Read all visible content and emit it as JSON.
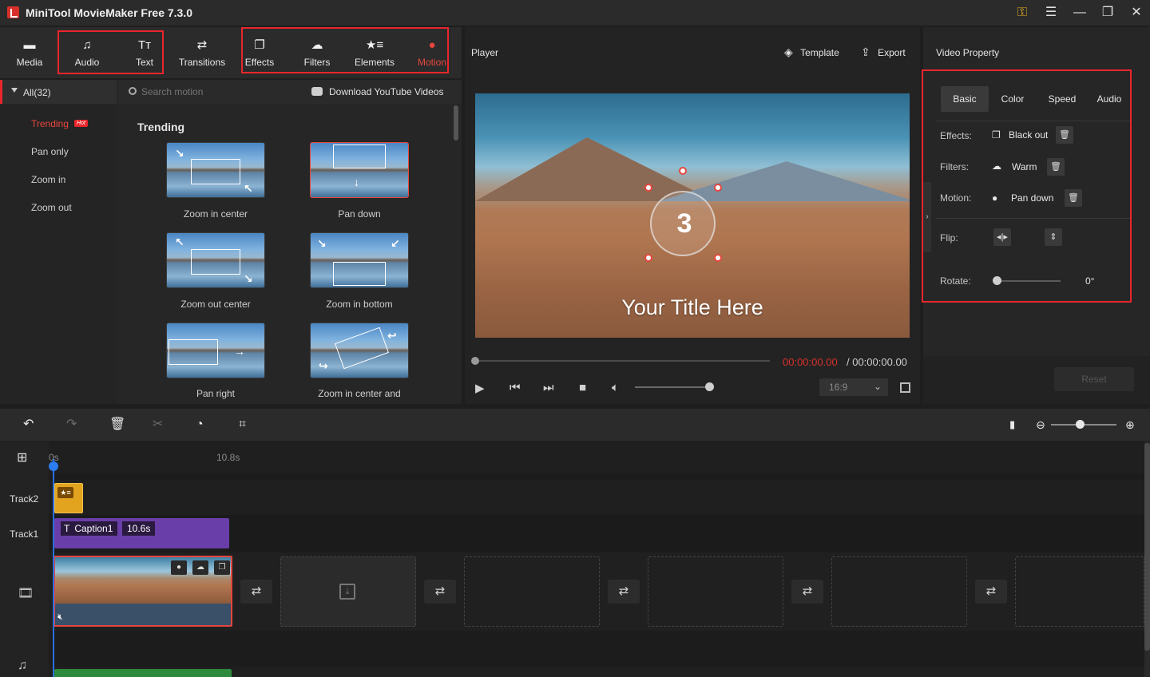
{
  "window": {
    "title": "MiniTool MovieMaker Free 7.3.0",
    "controls": [
      "key-icon",
      "menu-icon",
      "minimize-icon",
      "maximize-icon",
      "close-icon"
    ]
  },
  "toolbar": {
    "items": [
      {
        "label": "Media",
        "icon": "media-icon"
      },
      {
        "label": "Audio",
        "icon": "music-note-icon"
      },
      {
        "label": "Text",
        "icon": "text-icon"
      },
      {
        "label": "Transitions",
        "icon": "transitions-icon"
      },
      {
        "label": "Effects",
        "icon": "effects-icon"
      },
      {
        "label": "Filters",
        "icon": "filters-icon"
      },
      {
        "label": "Elements",
        "icon": "elements-icon"
      },
      {
        "label": "Motion",
        "icon": "motion-icon"
      }
    ],
    "active": "Motion",
    "accent": "#e8262c"
  },
  "library": {
    "category_header": "All(32)",
    "categories": [
      "Trending",
      "Pan only",
      "Zoom in",
      "Zoom out"
    ],
    "hot_badge": "Hot",
    "search_placeholder": "Search motion",
    "youtube_link": "Download YouTube Videos",
    "section_title": "Trending",
    "thumbnails": [
      {
        "label": "Zoom in center"
      },
      {
        "label": "Pan down"
      },
      {
        "label": "Zoom out center"
      },
      {
        "label": "Zoom in bottom"
      },
      {
        "label": "Pan right"
      },
      {
        "label": "Zoom in center and"
      }
    ]
  },
  "player": {
    "label": "Player",
    "template_label": "Template",
    "export_label": "Export",
    "video_title": "Your Title Here",
    "countdown": "3",
    "time_current": "00:00:00.00",
    "time_total": "/ 00:00:00.00",
    "aspect_ratio": "16:9"
  },
  "property": {
    "title": "Video Property",
    "tabs": [
      "Basic",
      "Color",
      "Speed",
      "Audio"
    ],
    "active_tab": "Basic",
    "rows": {
      "effects_label": "Effects:",
      "effects_value": "Black out",
      "filters_label": "Filters:",
      "filters_value": "Warm",
      "motion_label": "Motion:",
      "motion_value": "Pan down",
      "flip_label": "Flip:",
      "rotate_label": "Rotate:",
      "rotate_value": "0°"
    },
    "reset_label": "Reset"
  },
  "timeline": {
    "ruler": [
      "0s",
      "10.8s"
    ],
    "tracks": [
      "Track2",
      "Track1"
    ],
    "caption_clip": {
      "label": "Caption1",
      "duration": "10.6s"
    },
    "tools": [
      "undo-icon",
      "redo-icon",
      "delete-icon",
      "split-icon",
      "speed-icon",
      "crop-icon"
    ]
  }
}
